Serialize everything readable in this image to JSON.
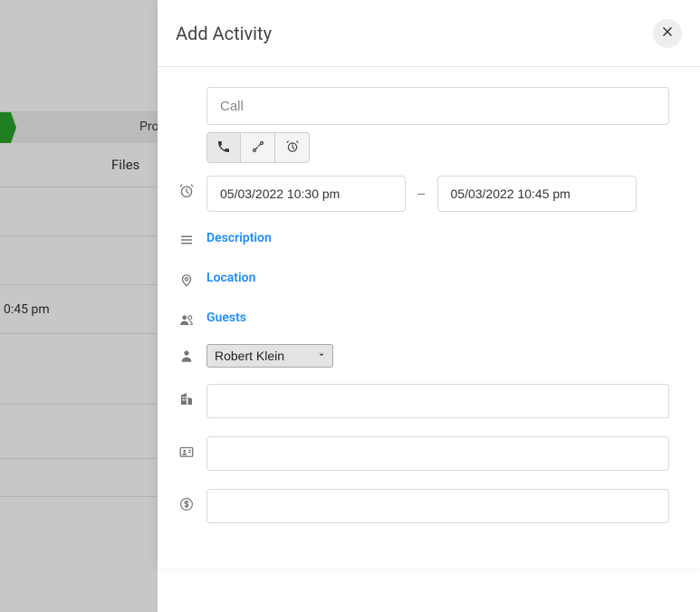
{
  "background": {
    "stage_fragment": "Pro",
    "tab_files": "Files",
    "time_label": "0:45 pm"
  },
  "panel": {
    "title": "Add Activity",
    "name_placeholder": "Call",
    "start": "05/03/2022 10:30 pm",
    "end": "05/03/2022 10:45 pm",
    "date_separator": "–",
    "link_description": "Description",
    "link_location": "Location",
    "link_guests": "Guests",
    "owner": "Robert Klein",
    "org_value": "",
    "contact_value": "",
    "deal_value": ""
  },
  "icons": {
    "close": "close-icon",
    "call": "phone-icon",
    "meeting": "route-icon",
    "task": "alarm-icon",
    "time": "clock-icon",
    "description": "list-icon",
    "location": "pin-icon",
    "guests": "people-icon",
    "owner": "person-icon",
    "org": "building-icon",
    "contact": "card-icon",
    "deal": "dollar-icon",
    "caret": "chevron-down-icon"
  }
}
